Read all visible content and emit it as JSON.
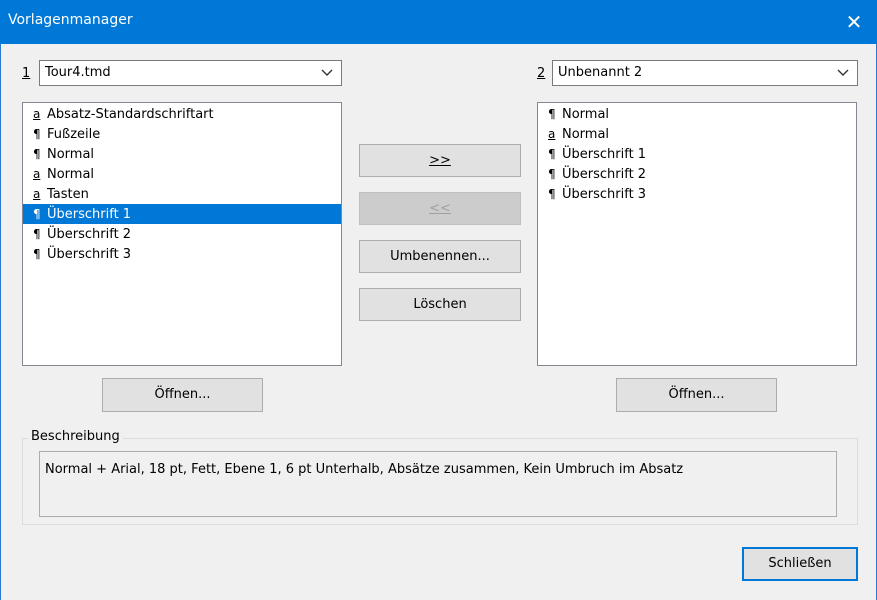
{
  "window": {
    "title": "Vorlagenmanager",
    "close_symbol": "✕"
  },
  "left": {
    "number": "1",
    "selected_file": "Tour4.tmd",
    "items": [
      {
        "glyph": "a",
        "label": "Absatz-Standardschriftart"
      },
      {
        "glyph": "¶",
        "label": "Fußzeile"
      },
      {
        "glyph": "¶",
        "label": "Normal"
      },
      {
        "glyph": "a",
        "label": "Normal"
      },
      {
        "glyph": "a",
        "label": "Tasten"
      },
      {
        "glyph": "¶",
        "label": "Überschrift 1"
      },
      {
        "glyph": "¶",
        "label": "Überschrift 2"
      },
      {
        "glyph": "¶",
        "label": "Überschrift 3"
      }
    ],
    "selected_index": 5,
    "open_button": "Öffnen..."
  },
  "right": {
    "number": "2",
    "selected_file": "Unbenannt 2",
    "items": [
      {
        "glyph": "¶",
        "label": "Normal"
      },
      {
        "glyph": "a",
        "label": "Normal"
      },
      {
        "glyph": "¶",
        "label": "Überschrift 1"
      },
      {
        "glyph": "¶",
        "label": "Überschrift 2"
      },
      {
        "glyph": "¶",
        "label": "Überschrift 3"
      }
    ],
    "open_button": "Öffnen..."
  },
  "middle": {
    "copy_right": ">>",
    "copy_left": "<<",
    "rename": "Umbenennen...",
    "delete": "Löschen"
  },
  "description": {
    "title": "Beschreibung",
    "text": "Normal + Arial, 18 pt, Fett, Ebene 1, 6 pt Unterhalb, Absätze zusammen, Kein Umbruch im Absatz"
  },
  "footer": {
    "close_button": "Schließen"
  }
}
